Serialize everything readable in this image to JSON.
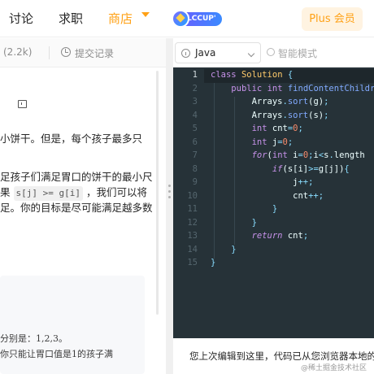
{
  "nav": {
    "items": [
      {
        "label": "讨论"
      },
      {
        "label": "求职"
      },
      {
        "label": "商店"
      }
    ],
    "lccup_label": "LCCUP' 23",
    "plus_label": "Plus 会员",
    "accent": "#ffa116"
  },
  "left": {
    "tab_count": "(2.2k)",
    "tab_history": "提交记录",
    "lines": [
      "小饼干。但是，每个孩子最多只",
      "足孩子们满足胃口的饼干的最小尺",
      "果",
      "，我们可以将",
      "足。你的目标是尽可能满足越多数"
    ],
    "chip_a": "s[j]  >= g[i]",
    "example_lines": [
      "分别是：1,2,3。",
      "你只能让胃口值是1的孩子满"
    ]
  },
  "editor": {
    "language": "Java",
    "smart_mode": "智能模式",
    "line_numbers": [
      "1",
      "2",
      "3",
      "4",
      "5",
      "6",
      "7",
      "8",
      "9",
      "10",
      "11",
      "12",
      "13",
      "14",
      "15"
    ],
    "notice": "您上次编辑到这里，代码已从您浏览器本地的缓"
  },
  "watermark": "@稀土掘金技术社区"
}
